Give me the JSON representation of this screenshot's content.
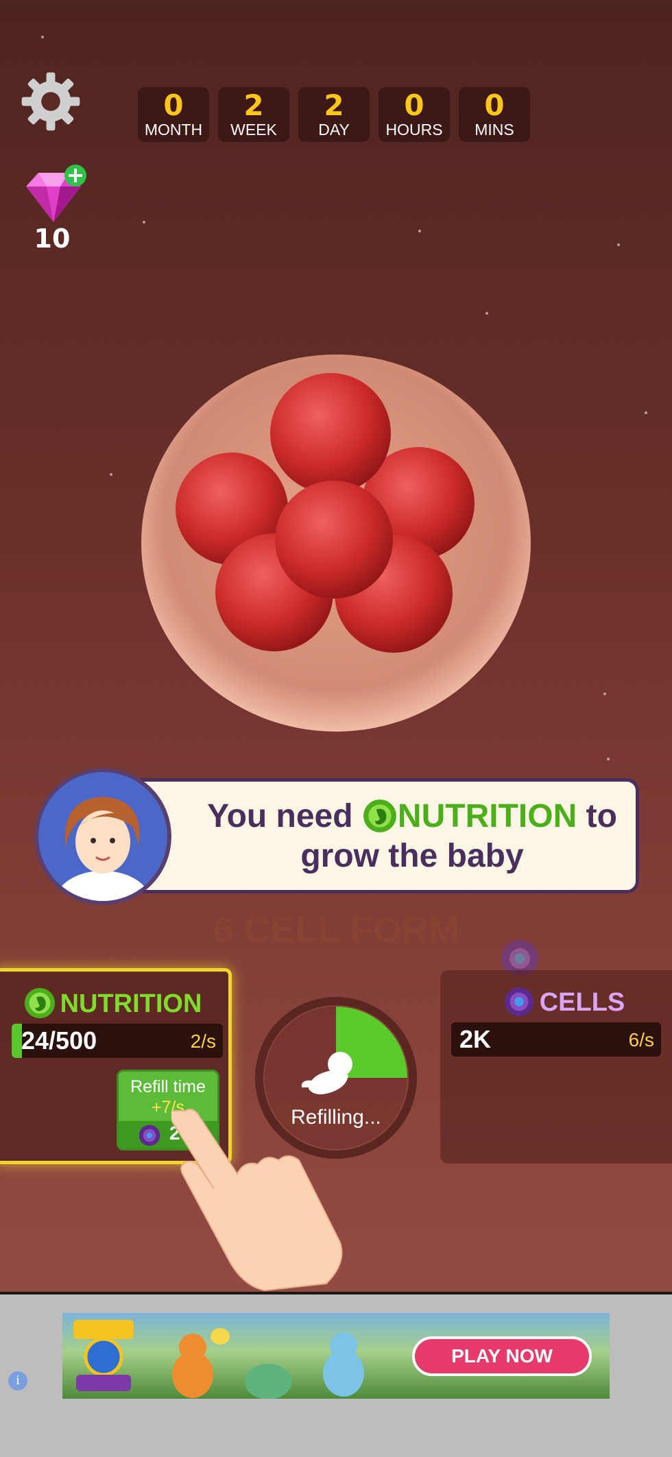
{
  "timer": [
    {
      "value": "0",
      "label": "MONTH"
    },
    {
      "value": "2",
      "label": "WEEK"
    },
    {
      "value": "2",
      "label": "DAY"
    },
    {
      "value": "0",
      "label": "HOURS"
    },
    {
      "value": "0",
      "label": "MINS"
    }
  ],
  "gems": {
    "count": "10",
    "icon": "pink-gem-icon"
  },
  "dialogue": {
    "line1_pre": "You need",
    "keyword": "NUTRITION",
    "line1_post": "to",
    "line2": "grow the baby"
  },
  "stage": "6 CELL FORM",
  "nutrition": {
    "title": "NUTRITION",
    "value": "24/500",
    "rate": "2/s",
    "fill_fraction": 0.048,
    "refill": {
      "label": "Refill time",
      "bonus": "+7/s",
      "cost": "20"
    }
  },
  "cells": {
    "title": "CELLS",
    "value": "2K",
    "rate": "6/s"
  },
  "progress": {
    "status": "Refilling...",
    "fraction": 0.25
  },
  "ad": {
    "button": "PLAY NOW",
    "info": "i"
  },
  "colors": {
    "accent_gold": "#ffc61a",
    "nutrition_green": "#58c82c",
    "cells_purple": "#d9a6f4",
    "ad_pink": "#e63a6a"
  }
}
